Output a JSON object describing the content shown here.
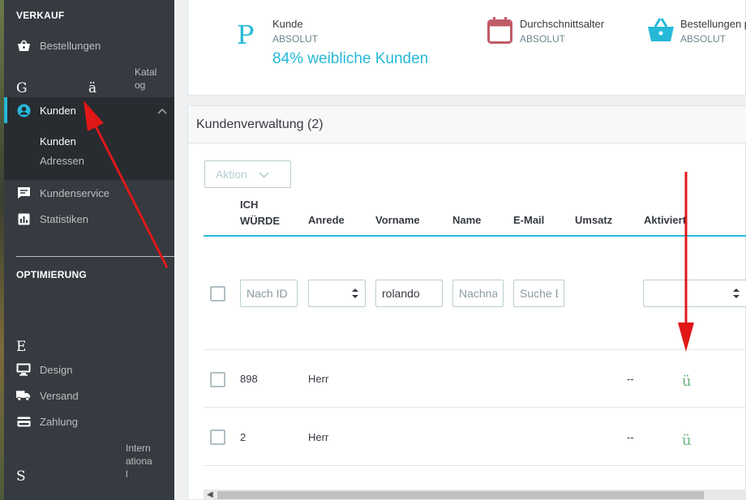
{
  "sidebar": {
    "sections": {
      "sell": "VERKAUF",
      "improve": "OPTIMIERUNG"
    },
    "items": {
      "orders": "Bestellungen",
      "catalog": "Katalog",
      "catalog_glitch_1": "G",
      "catalog_glitch_2": "ä",
      "customers": "Kunden",
      "customer_service": "Kundenservice",
      "stats": "Statistiken",
      "modules_glitch": "E",
      "design": "Design",
      "shipping": "Versand",
      "payment": "Zahlung",
      "international_1": "Intern",
      "international_2": "ationa",
      "international_3": "l",
      "international_glitch": "S"
    },
    "customers_sub": [
      "Kunden",
      "Adressen"
    ]
  },
  "kpi": {
    "customer_icon_glyph": "P",
    "customer_label": "Kunde",
    "customer_sub": "ABSOLUT",
    "customer_value": "84% weibliche Kunden",
    "age_label": "Durchschnittsalter",
    "age_sub": "ABSOLUT",
    "orders_label": "Bestellungen p",
    "orders_sub": "ABSOLUT"
  },
  "panel": {
    "title": "Kundenverwaltung (2)",
    "bulk_action": "Aktion",
    "columns": {
      "id_line1": "ICH",
      "id_line2": "WÜRDE",
      "salutation": "Anrede",
      "firstname": "Vorname",
      "lastname": "Name",
      "email": "E-Mail",
      "sales": "Umsatz",
      "active": "Aktiviert"
    },
    "filters": {
      "id_placeholder": "Nach ID",
      "firstname_value": "rolando",
      "lastname_placeholder": "Nachname",
      "email_placeholder": "Suche E"
    },
    "rows": [
      {
        "id": "898",
        "salutation": "Herr",
        "sales": "--",
        "active": "ü"
      },
      {
        "id": "2",
        "salutation": "Herr",
        "sales": "--",
        "active": "ü"
      }
    ]
  },
  "colors": {
    "sidebar_bg": "#363a41",
    "accent": "#25b9d7",
    "age_icon": "#c05c67",
    "arrow": "#e01818",
    "check": "#70b580"
  },
  "icons": {
    "orders": "basket-icon",
    "customers": "user-circle-icon",
    "customer_service": "chat-icon",
    "stats": "chart-icon",
    "design": "monitor-icon",
    "shipping": "truck-icon",
    "payment": "credit-card-icon",
    "age": "calendar-icon",
    "orders_kpi": "basket-icon"
  }
}
